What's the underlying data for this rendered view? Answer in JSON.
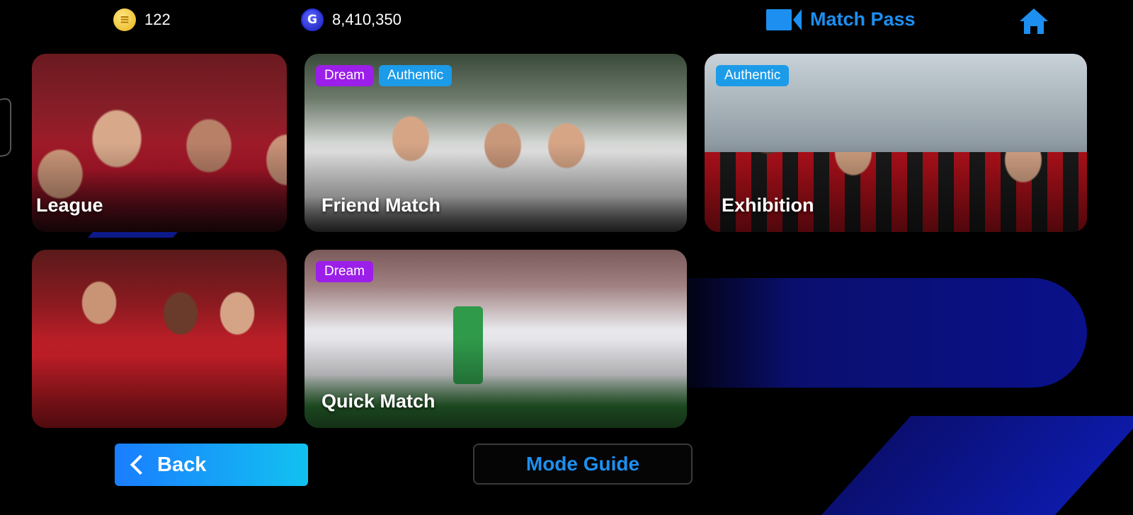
{
  "header": {
    "coins": "122",
    "gp": "8,410,350",
    "match_pass_label": "Match Pass"
  },
  "tiles": [
    {
      "label": "League",
      "badges": []
    },
    {
      "label": "Friend Match",
      "badges": [
        "Dream",
        "Authentic"
      ]
    },
    {
      "label": "Exhibition",
      "badges": [
        "Authentic"
      ]
    },
    {
      "label": "",
      "badges": []
    },
    {
      "label": "Quick Match",
      "badges": [
        "Dream"
      ]
    }
  ],
  "footer": {
    "back_label": "Back",
    "guide_label": "Mode Guide"
  },
  "colors": {
    "accent": "#1d8ff0",
    "dream": "#9b1fe8",
    "authentic": "#1c9be8"
  }
}
